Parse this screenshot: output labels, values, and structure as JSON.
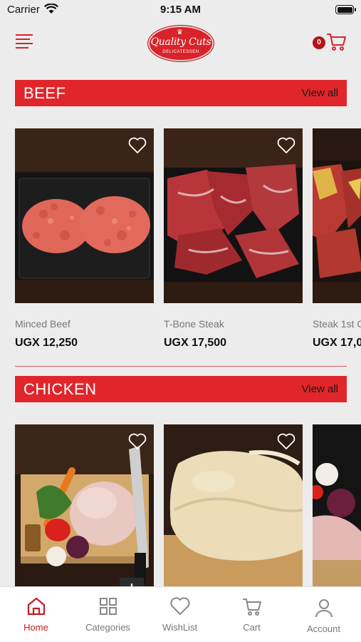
{
  "status_bar": {
    "carrier": "Carrier",
    "time": "9:15 AM"
  },
  "header": {
    "logo_name": "Quality Cuts",
    "logo_tagline": "DELICATESSEN",
    "cart_count": "0"
  },
  "colors": {
    "brand_red": "#e1262b",
    "dark_red": "#b3141b",
    "background": "#ececec"
  },
  "sections": [
    {
      "title": "BEEF",
      "view_all": "View all",
      "products": [
        {
          "name": "Minced Beef",
          "price": "UGX 12,250"
        },
        {
          "name": "T-Bone Steak",
          "price": "UGX 17,500"
        },
        {
          "name": "Steak 1st C",
          "price": "UGX 17,0"
        }
      ]
    },
    {
      "title": "CHICKEN",
      "view_all": "View all",
      "products": [
        {
          "name": "",
          "price": ""
        },
        {
          "name": "",
          "price": ""
        },
        {
          "name": "",
          "price": ""
        }
      ]
    }
  ],
  "add_button_label": "+",
  "tabs": [
    {
      "label": "Home",
      "icon": "home-icon",
      "active": true
    },
    {
      "label": "Categories",
      "icon": "grid-icon",
      "active": false
    },
    {
      "label": "WishList",
      "icon": "heart-icon",
      "active": false
    },
    {
      "label": "Cart",
      "icon": "cart-icon",
      "active": false
    },
    {
      "label": "Account",
      "icon": "user-icon",
      "active": false
    }
  ]
}
